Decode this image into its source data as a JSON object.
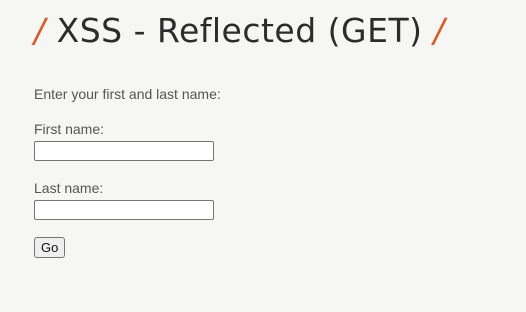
{
  "header": {
    "title": "XSS - Reflected (GET)",
    "left_slash": "/",
    "right_slash": "/",
    "accent_color": "#e0561f"
  },
  "form": {
    "instruction": "Enter your first and last name:",
    "first_name_label": "First name:",
    "first_name_value": "",
    "last_name_label": "Last name:",
    "last_name_value": "",
    "submit_label": "Go"
  }
}
